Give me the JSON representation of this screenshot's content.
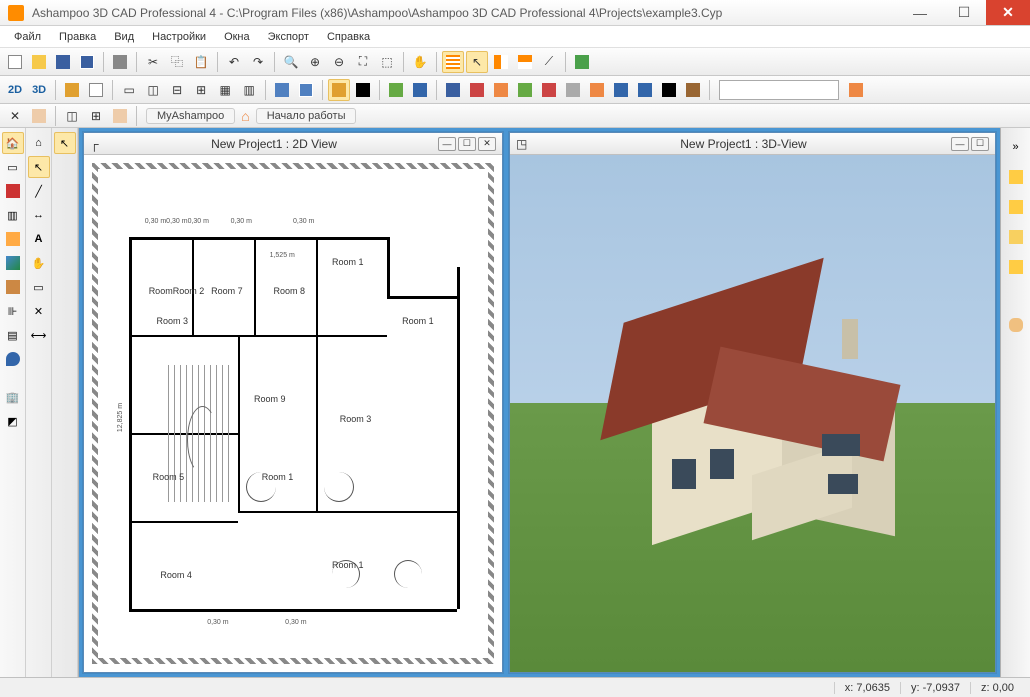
{
  "title": "Ashampoo 3D CAD Professional 4 - C:\\Program Files (x86)\\Ashampoo\\Ashampoo 3D CAD Professional 4\\Projects\\example3.Cyp",
  "menu": [
    "Файл",
    "Правка",
    "Вид",
    "Настройки",
    "Окна",
    "Экспорт",
    "Справка"
  ],
  "toolbar2": {
    "label2d": "2D",
    "label3d": "3D"
  },
  "quicklinks": {
    "my": "MyAshampoo",
    "start": "Начало работы"
  },
  "views": {
    "left_title": "New Project1 : 2D View",
    "right_title": "New Project1 : 3D-View"
  },
  "rooms": {
    "r1": "Room 1",
    "r1b": "Room 1",
    "r1c": "Room 1",
    "r1d": "Room 1",
    "r2": "Room 2",
    "r2b": "RoomRoom 2",
    "r3": "Room 3",
    "r3b": "Room 3",
    "r4": "Room 4",
    "r5": "Room 5",
    "r7": "Room 7",
    "r8": "Room 8",
    "r9": "Room 9"
  },
  "dims": {
    "d1": "0,30 m",
    "d2": "0,30 m",
    "d3": "0,30 m",
    "d4": "0,30 m",
    "d5": "1,525 m",
    "d6": "12,825 m",
    "d7": "0,30 m0,30 m0,30 m"
  },
  "status": {
    "x_label": "x:",
    "x_val": "7,0635",
    "y_label": "y:",
    "y_val": "-7,0937",
    "z_label": "z:",
    "z_val": "0,00"
  }
}
